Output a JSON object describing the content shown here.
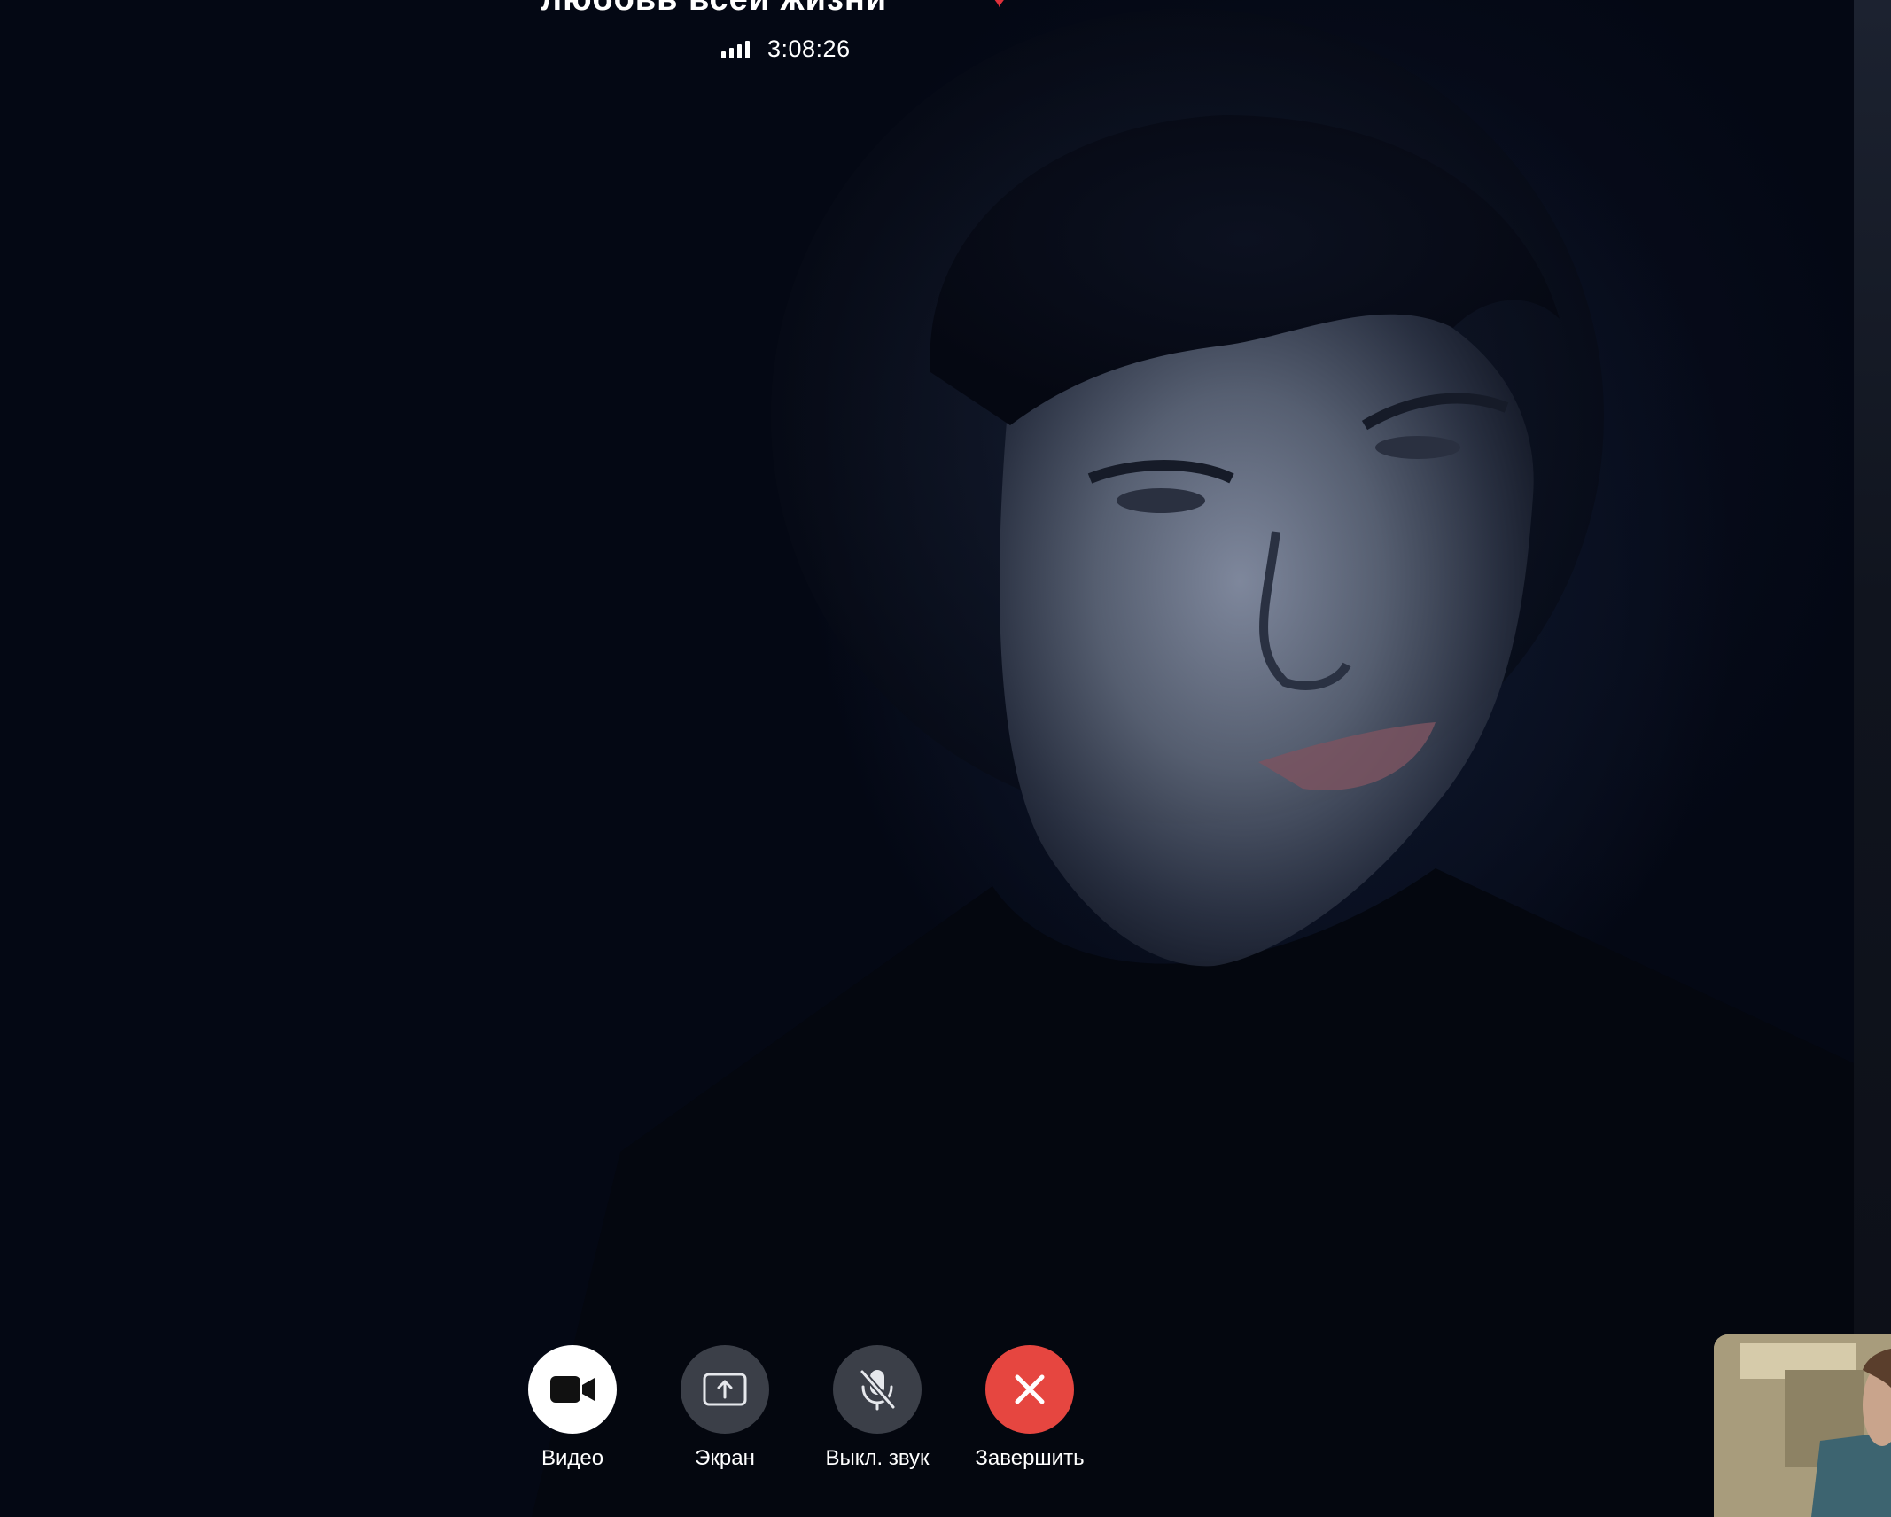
{
  "call": {
    "title": "любовь всей жизни",
    "duration": "3:08:26",
    "signal_bars": 4
  },
  "controls": [
    {
      "label": "Видео",
      "icon": "video-camera-icon",
      "style": "white"
    },
    {
      "label": "Экран",
      "icon": "screen-share-icon",
      "style": "grey"
    },
    {
      "label": "Выкл. звук",
      "icon": "mic-off-icon",
      "style": "grey"
    },
    {
      "label": "Завершить",
      "icon": "close-icon",
      "style": "red"
    }
  ],
  "colors": {
    "background": "#030612",
    "end_call": "#e64640",
    "control_grey": "#3b3f48",
    "heart": "#e0303a"
  }
}
